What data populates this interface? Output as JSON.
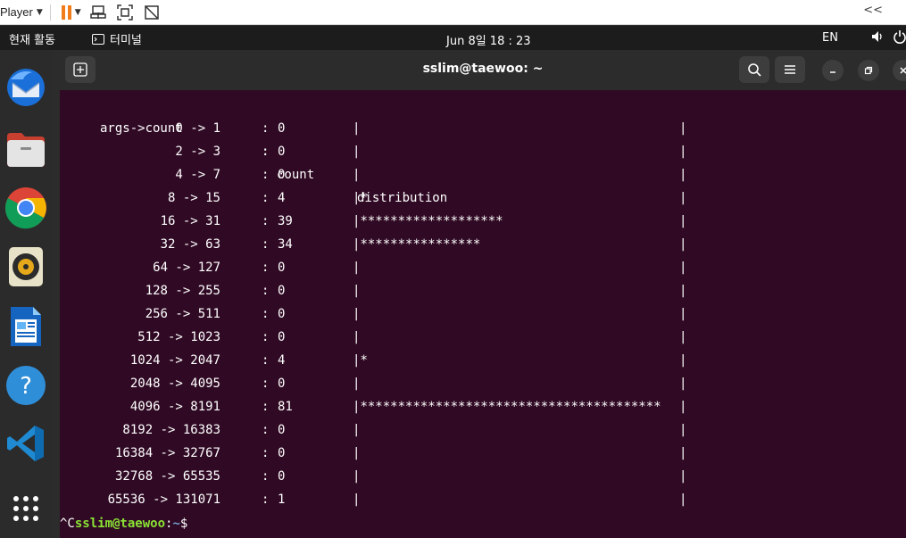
{
  "player_bar": {
    "label": "Player",
    "collapse_label": "<<"
  },
  "top_bar": {
    "activities": "현재 활동",
    "app_name": "터미널",
    "clock": "Jun 8일  18 : 23",
    "language": "EN"
  },
  "dock": {
    "items": [
      "thunderbird-icon",
      "files-icon",
      "chrome-icon",
      "rhythmbox-icon",
      "libreoffice-writer-icon",
      "help-icon",
      "vscode-icon",
      "show-apps-icon"
    ]
  },
  "terminal": {
    "title": "sslim@taewoo: ~",
    "header": {
      "args": "args->count",
      "sep": ":",
      "count": "count",
      "distribution": "distribution"
    },
    "rows": [
      {
        "range": "0 -> 1",
        "count": "0",
        "bar": ""
      },
      {
        "range": "2 -> 3",
        "count": "0",
        "bar": ""
      },
      {
        "range": "4 -> 7",
        "count": "0",
        "bar": ""
      },
      {
        "range": "8 -> 15",
        "count": "4",
        "bar": "*"
      },
      {
        "range": "16 -> 31",
        "count": "39",
        "bar": "*******************"
      },
      {
        "range": "32 -> 63",
        "count": "34",
        "bar": "****************"
      },
      {
        "range": "64 -> 127",
        "count": "0",
        "bar": ""
      },
      {
        "range": "128 -> 255",
        "count": "0",
        "bar": ""
      },
      {
        "range": "256 -> 511",
        "count": "0",
        "bar": ""
      },
      {
        "range": "512 -> 1023",
        "count": "0",
        "bar": ""
      },
      {
        "range": "1024 -> 2047",
        "count": "4",
        "bar": "*"
      },
      {
        "range": "2048 -> 4095",
        "count": "0",
        "bar": ""
      },
      {
        "range": "4096 -> 8191",
        "count": "81",
        "bar": "****************************************"
      },
      {
        "range": "8192 -> 16383",
        "count": "0",
        "bar": ""
      },
      {
        "range": "16384 -> 32767",
        "count": "0",
        "bar": ""
      },
      {
        "range": "32768 -> 65535",
        "count": "0",
        "bar": ""
      },
      {
        "range": "65536 -> 131071",
        "count": "1",
        "bar": ""
      }
    ],
    "prompt": {
      "interrupt": "^C",
      "user_host": "sslim@taewoo",
      "colon": ":",
      "path": "~",
      "symbol": "$"
    }
  }
}
